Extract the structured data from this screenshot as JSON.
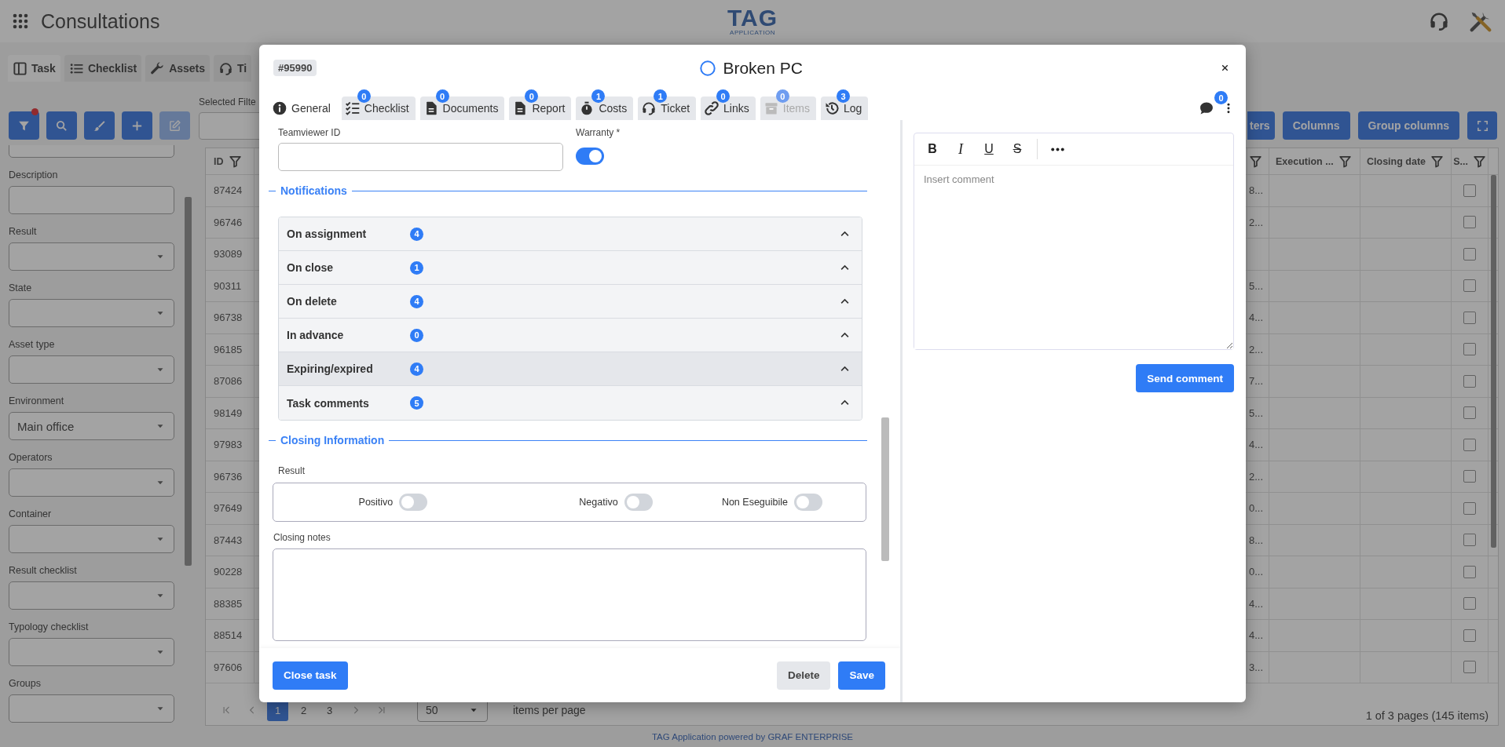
{
  "app_bar": {
    "title": "Consultations",
    "logo": {
      "text": "TAG",
      "subtext": "APPLICATION"
    }
  },
  "page_tabs": [
    {
      "label": "Task",
      "selected": true
    },
    {
      "label": "Checklist",
      "selected": false
    },
    {
      "label": "Assets",
      "selected": false
    },
    {
      "label": "Ti",
      "selected": false
    }
  ],
  "toolbar": {
    "buttons": [
      {
        "disabled": false,
        "indicator": true
      },
      {
        "disabled": false,
        "indicator": false
      },
      {
        "disabled": false,
        "indicator": false
      },
      {
        "disabled": false,
        "indicator": false
      },
      {
        "disabled": true,
        "indicator": false
      }
    ],
    "selected_filters_label": "Selected Filte",
    "right_buttons": [
      {
        "label": "ters"
      },
      {
        "label": "Columns"
      },
      {
        "label": "Group columns"
      }
    ]
  },
  "filters": [
    {
      "kind": "text"
    },
    {
      "kind": "text",
      "label": "Description"
    },
    {
      "kind": "select",
      "label": "Result"
    },
    {
      "kind": "select",
      "label": "State"
    },
    {
      "kind": "select",
      "label": "Asset type"
    },
    {
      "kind": "select",
      "label": "Environment",
      "value": "Main office"
    },
    {
      "kind": "select",
      "label": "Operators"
    },
    {
      "kind": "select",
      "label": "Container"
    },
    {
      "kind": "select",
      "label": "Result checklist"
    },
    {
      "kind": "select",
      "label": "Typology checklist"
    },
    {
      "kind": "select",
      "label": "Groups"
    }
  ],
  "table": {
    "columns": [
      {
        "label": "ID"
      },
      {
        "label": "Execution ..."
      },
      {
        "label": "Closing date"
      },
      {
        "label": "S..."
      }
    ],
    "rows": [
      {
        "id": "87424",
        "column_2": "8...",
        "checked": false
      },
      {
        "id": "96746",
        "column_2": "2...",
        "checked": false
      },
      {
        "id": "93089",
        "checked": false
      },
      {
        "id": "90311",
        "column_2": "5...",
        "checked": false
      },
      {
        "id": "96738",
        "column_2": "4...",
        "checked": false
      },
      {
        "id": "96185",
        "column_2": "2...",
        "checked": false
      },
      {
        "id": "87086",
        "column_2": "7...",
        "checked": false
      },
      {
        "id": "98149",
        "column_2": "5...",
        "checked": false
      },
      {
        "id": "97983",
        "column_2": "4...",
        "checked": false
      },
      {
        "id": "96736",
        "column_2": "2...",
        "checked": false
      },
      {
        "id": "97649",
        "column_2": "0...",
        "checked": false
      },
      {
        "id": "87443",
        "column_2": "8...",
        "checked": false
      },
      {
        "id": "90228",
        "column_2": "0...",
        "checked": false
      },
      {
        "id": "88385",
        "column_2": "4...",
        "checked": false
      },
      {
        "id": "88514",
        "column_2": "4...",
        "checked": false
      },
      {
        "id": "97606",
        "column_2": "3...",
        "checked": false
      }
    ]
  },
  "pagination": {
    "pages": [
      {
        "label": "1",
        "selected": true
      },
      {
        "label": "2",
        "selected": false
      },
      {
        "label": "3",
        "selected": false
      }
    ],
    "page_size": "50",
    "page_size_label": "items per page",
    "summary": "1 of 3 pages (145 items)"
  },
  "footer": "TAG Application powered by GRAF ENTERPRISE",
  "modal": {
    "code": "#95990",
    "title": "Broken PC",
    "tabs": [
      {
        "label": "General",
        "selected": true,
        "disabled": false
      },
      {
        "label": "Checklist",
        "badge": "0",
        "selected": false,
        "disabled": false
      },
      {
        "label": "Documents",
        "badge": "0",
        "selected": false,
        "disabled": false
      },
      {
        "label": "Report",
        "badge": "0",
        "selected": false,
        "disabled": false
      },
      {
        "label": "Costs",
        "badge": "1",
        "selected": false,
        "disabled": false
      },
      {
        "label": "Ticket",
        "badge": "1",
        "selected": false,
        "disabled": false
      },
      {
        "label": "Links",
        "badge": "0",
        "selected": false,
        "disabled": false
      },
      {
        "label": "Items",
        "badge": "0",
        "selected": false,
        "disabled": true
      },
      {
        "label": "Log",
        "badge": "3",
        "selected": false,
        "disabled": false
      }
    ],
    "chat_badge": "0",
    "teamviewer_label": "Teamviewer ID",
    "warranty": {
      "label": "Warranty *",
      "on": true
    },
    "notifications": {
      "title": "Notifications",
      "items": [
        {
          "label": "On assignment",
          "count": "4",
          "highlighted": false
        },
        {
          "label": "On close",
          "count": "1",
          "highlighted": false
        },
        {
          "label": "On delete",
          "count": "4",
          "highlighted": false
        },
        {
          "label": "In advance",
          "count": "0",
          "highlighted": false
        },
        {
          "label": "Expiring/expired",
          "count": "4",
          "highlighted": true
        },
        {
          "label": "Task comments",
          "count": "5",
          "highlighted": false
        }
      ]
    },
    "closing": {
      "title": "Closing Information",
      "result_label": "Result",
      "options": [
        {
          "label": "Positivo",
          "on": false
        },
        {
          "label": "Negativo",
          "on": false
        },
        {
          "label": "Non Eseguibile",
          "on": false
        }
      ],
      "notes_label": "Closing notes"
    },
    "actions": {
      "close_task": "Close task",
      "delete": "Delete",
      "save": "Save"
    },
    "comment": {
      "toolbar": [
        {
          "label": "B",
          "kind": "bold"
        },
        {
          "label": "I",
          "kind": "italic"
        },
        {
          "label": "U",
          "kind": "underline"
        },
        {
          "label": "S",
          "kind": "strike"
        }
      ],
      "placeholder": "Insert comment",
      "send": "Send comment"
    }
  }
}
